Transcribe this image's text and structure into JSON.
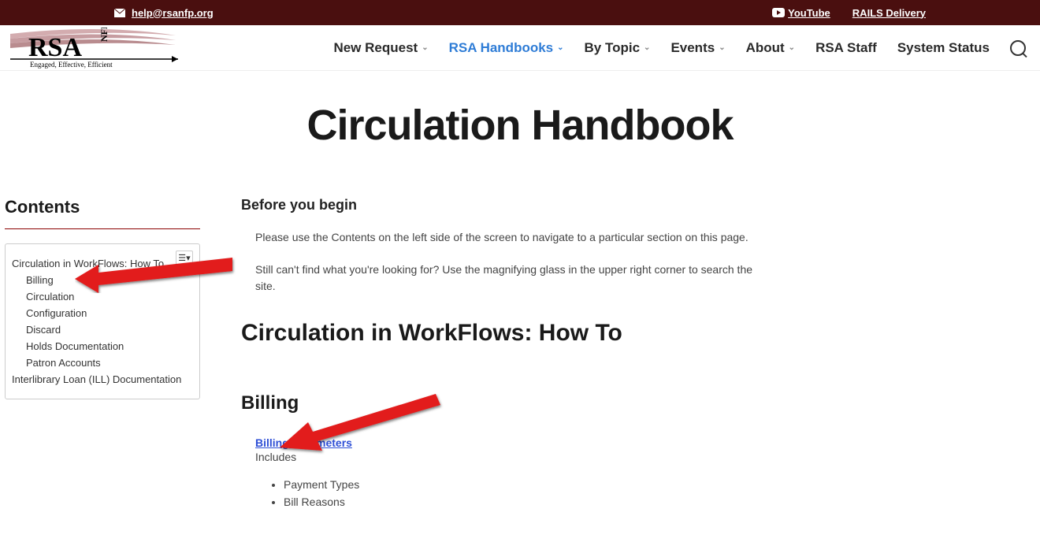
{
  "topbar": {
    "email": "help@rsanfp.org",
    "youtube": "YouTube",
    "rails": "RAILS Delivery"
  },
  "logo": {
    "text_main": "RSA",
    "text_side": "NFP",
    "tagline": "Engaged, Effective, Efficient"
  },
  "nav": {
    "items": [
      {
        "label": "New Request",
        "dropdown": true,
        "active": false
      },
      {
        "label": "RSA Handbooks",
        "dropdown": true,
        "active": true
      },
      {
        "label": "By Topic",
        "dropdown": true,
        "active": false
      },
      {
        "label": "Events",
        "dropdown": true,
        "active": false
      },
      {
        "label": "About",
        "dropdown": true,
        "active": false
      },
      {
        "label": "RSA Staff",
        "dropdown": false,
        "active": false
      },
      {
        "label": "System Status",
        "dropdown": false,
        "active": false
      }
    ]
  },
  "page": {
    "title": "Circulation Handbook"
  },
  "sidebar": {
    "title": "Contents",
    "toc": [
      {
        "label": "Circulation in WorkFlows: How To",
        "level": 1
      },
      {
        "label": "Billing",
        "level": 2
      },
      {
        "label": "Circulation",
        "level": 2
      },
      {
        "label": "Configuration",
        "level": 2
      },
      {
        "label": "Discard",
        "level": 2
      },
      {
        "label": "Holds Documentation",
        "level": 2
      },
      {
        "label": "Patron Accounts",
        "level": 2
      },
      {
        "label": "Interlibrary Loan (ILL) Documentation",
        "level": 1
      }
    ]
  },
  "article": {
    "before_heading": "Before you begin",
    "para1": "Please use the Contents on the left side of the screen to navigate to a particular section on this page.",
    "para2": "Still can't find what you're looking for? Use the magnifying glass in the upper right corner to search the site.",
    "section_heading": "Circulation in WorkFlows: How To",
    "subsection_heading": "Billing",
    "link_label": "Billing Parameters",
    "includes_label": "Includes",
    "bullets": [
      "Payment Types",
      "Bill Reasons"
    ]
  }
}
